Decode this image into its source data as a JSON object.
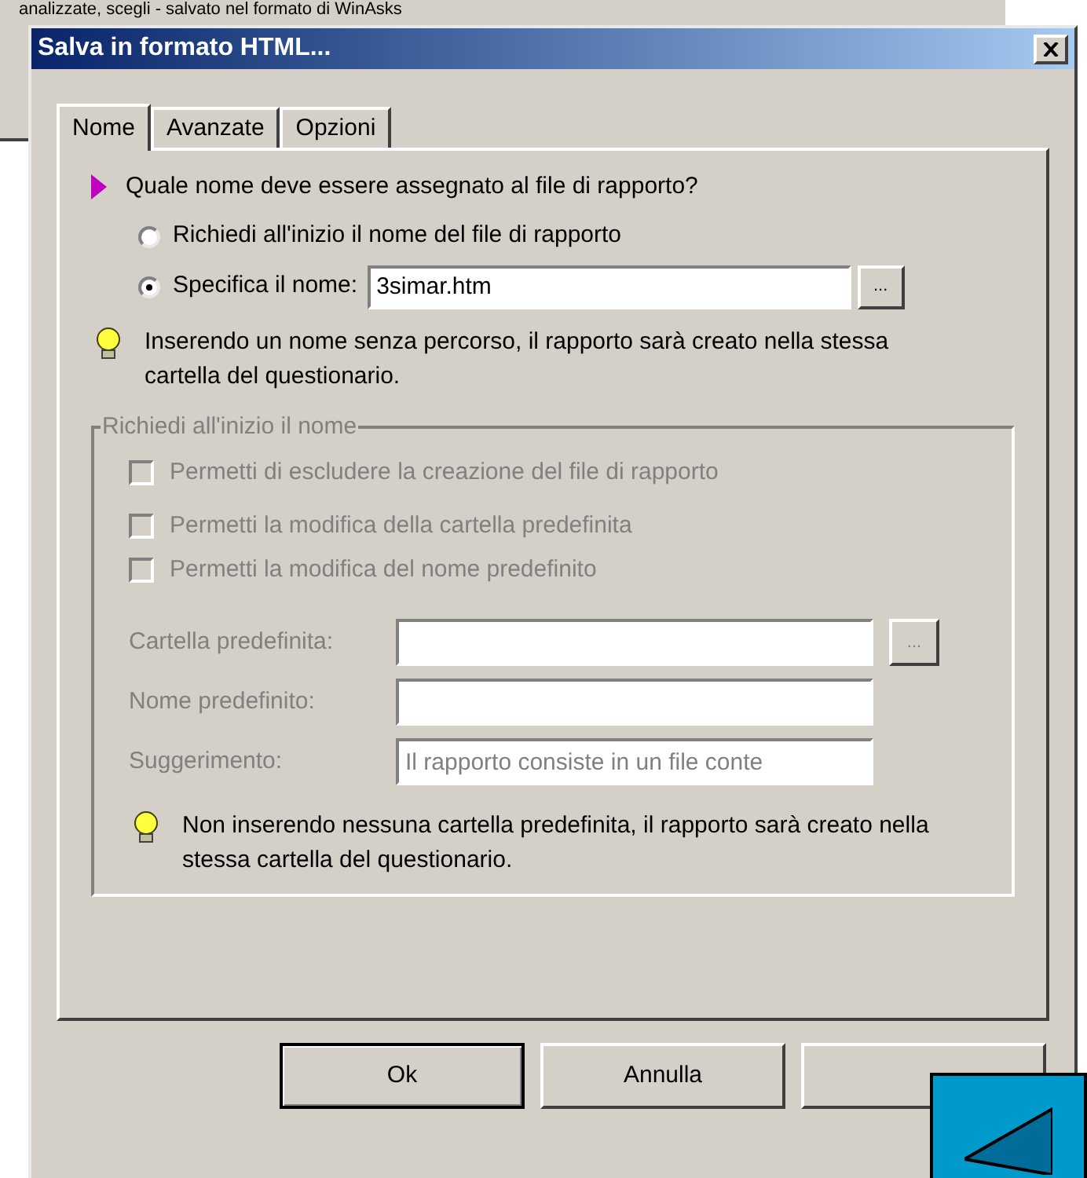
{
  "background_window": {
    "text": "analizzate, scegli - salvato nel formato di WinAsks"
  },
  "window": {
    "title": "Salva in formato HTML..."
  },
  "tabs": [
    {
      "label": "Nome",
      "selected": true
    },
    {
      "label": "Avanzate",
      "selected": false
    },
    {
      "label": "Opzioni",
      "selected": false
    }
  ],
  "question": "Quale nome deve essere assegnato al file di rapporto?",
  "options": [
    {
      "label": "Richiedi all'inizio il nome del file di rapporto",
      "selected": false
    },
    {
      "label": "Specifica il nome:",
      "selected": true,
      "value": "3simar.htm",
      "browse": "..."
    }
  ],
  "hint": "Inserendo un nome senza percorso, il rapporto sarà creato nella stessa cartella del questionario.",
  "group": {
    "title": "Richiedi all'inizio il nome",
    "disabled": true,
    "checkboxes": [
      {
        "label": "Permetti di escludere la creazione del file di rapporto",
        "checked": false
      },
      {
        "label": "Permetti la modifica della cartella predefinita",
        "checked": false
      },
      {
        "label": "Permetti la modifica del nome predefinito",
        "checked": false
      }
    ],
    "fields": [
      {
        "label": "Cartella predefinita:",
        "browse": "..."
      },
      {
        "label": "Nome predefinito:"
      },
      {
        "label": "Suggerimento:",
        "value": "Il rapporto consiste in un file conte"
      }
    ],
    "hint": "Non inserendo nessuna cartella predefinita, il rapporto sarà creato nella stessa cartella del questionario."
  },
  "buttons": [
    {
      "label": "Ok",
      "default": true
    },
    {
      "label": "Annulla",
      "default": false
    }
  ]
}
